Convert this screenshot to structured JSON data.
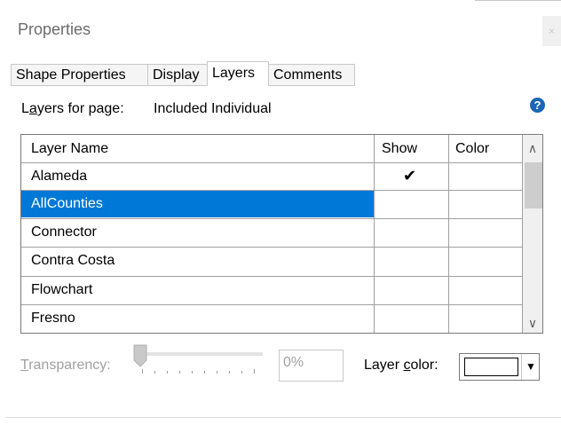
{
  "window": {
    "title": "Properties",
    "close_glyph": "×"
  },
  "tabs": [
    {
      "label": "Shape Properties",
      "active": false
    },
    {
      "label": "Display",
      "active": false
    },
    {
      "label": "Layers",
      "active": true
    },
    {
      "label": "Comments",
      "active": false
    }
  ],
  "layers_for_page": {
    "label_prefix": "L",
    "label_underlined": "a",
    "label_suffix": "yers for page:",
    "value": "Included Individual"
  },
  "help_glyph": "?",
  "grid": {
    "headers": [
      "Layer Name",
      "Show",
      "Color"
    ],
    "rows": [
      {
        "name": "Alameda",
        "show": "✔",
        "selected": false
      },
      {
        "name": "AllCounties",
        "show": "",
        "selected": true
      },
      {
        "name": "Connector",
        "show": "",
        "selected": false
      },
      {
        "name": "Contra Costa",
        "show": "",
        "selected": false
      },
      {
        "name": "Flowchart",
        "show": "",
        "selected": false
      },
      {
        "name": "Fresno",
        "show": "",
        "selected": false
      }
    ],
    "scroll_up_glyph": "∧",
    "scroll_down_glyph": "∨"
  },
  "transparency": {
    "label_underlined": "T",
    "label_rest": "ransparency:",
    "value": "0%",
    "slider_fraction": 0
  },
  "layer_color": {
    "label_prefix": "Layer ",
    "label_underlined": "c",
    "label_suffix": "olor:",
    "swatch": "#ffffff",
    "arrow_glyph": "▼"
  },
  "colors": {
    "selection": "#0078d7",
    "help": "#1a66b8"
  }
}
